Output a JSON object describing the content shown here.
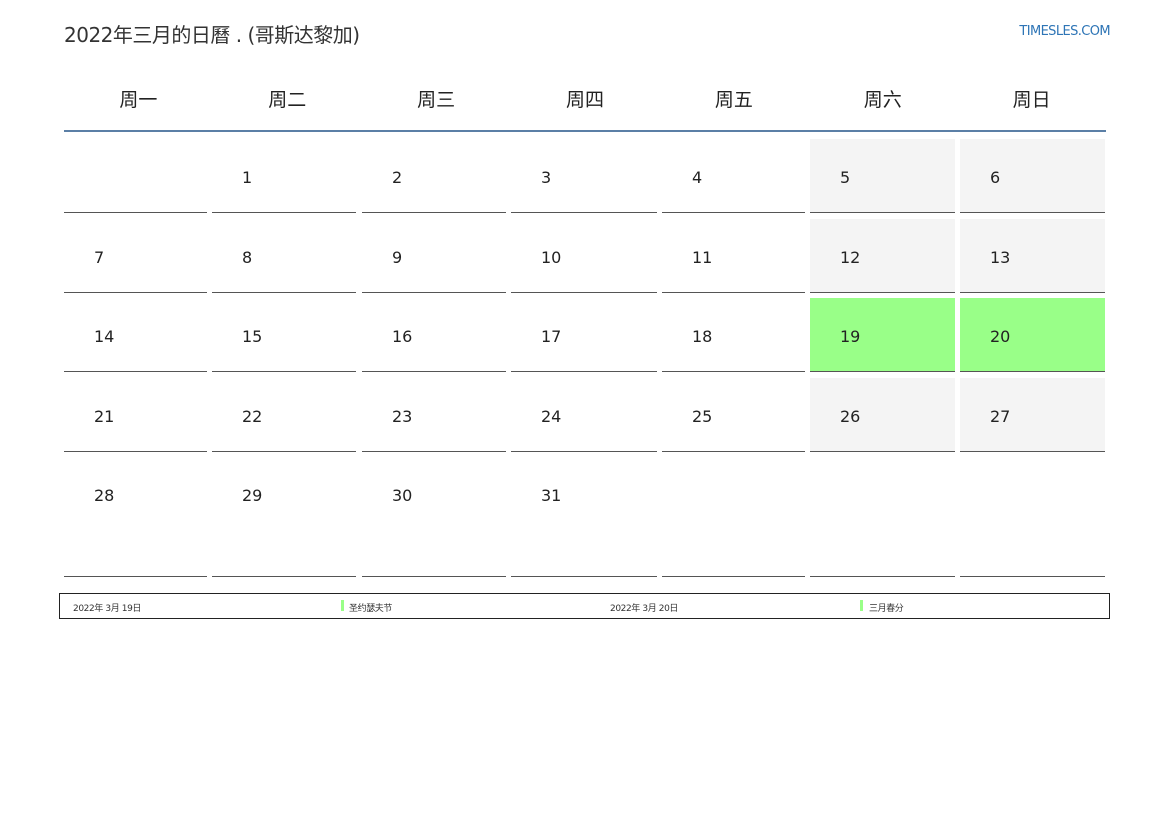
{
  "header": {
    "title": "2022年三月的日曆 . (哥斯达黎加)",
    "site": "TIMESLES.COM"
  },
  "weekdays": [
    "周一",
    "周二",
    "周三",
    "周四",
    "周五",
    "周六",
    "周日"
  ],
  "weeks": [
    [
      "",
      "1",
      "2",
      "3",
      "4",
      "5",
      "6"
    ],
    [
      "7",
      "8",
      "9",
      "10",
      "11",
      "12",
      "13"
    ],
    [
      "14",
      "15",
      "16",
      "17",
      "18",
      "19",
      "20"
    ],
    [
      "21",
      "22",
      "23",
      "24",
      "25",
      "26",
      "27"
    ],
    [
      "28",
      "29",
      "30",
      "31",
      "",
      "",
      ""
    ]
  ],
  "holidays": [
    {
      "date": "2022年 3月 19日",
      "name": "圣约瑟夫节"
    },
    {
      "date": "2022年 3月 20日",
      "name": "三月春分"
    }
  ],
  "colors": {
    "holiday_fill": "#99ff88",
    "weekend_fill": "#f4f4f4",
    "header_rule": "#5b7fa6",
    "site_link": "#2e75b6"
  }
}
